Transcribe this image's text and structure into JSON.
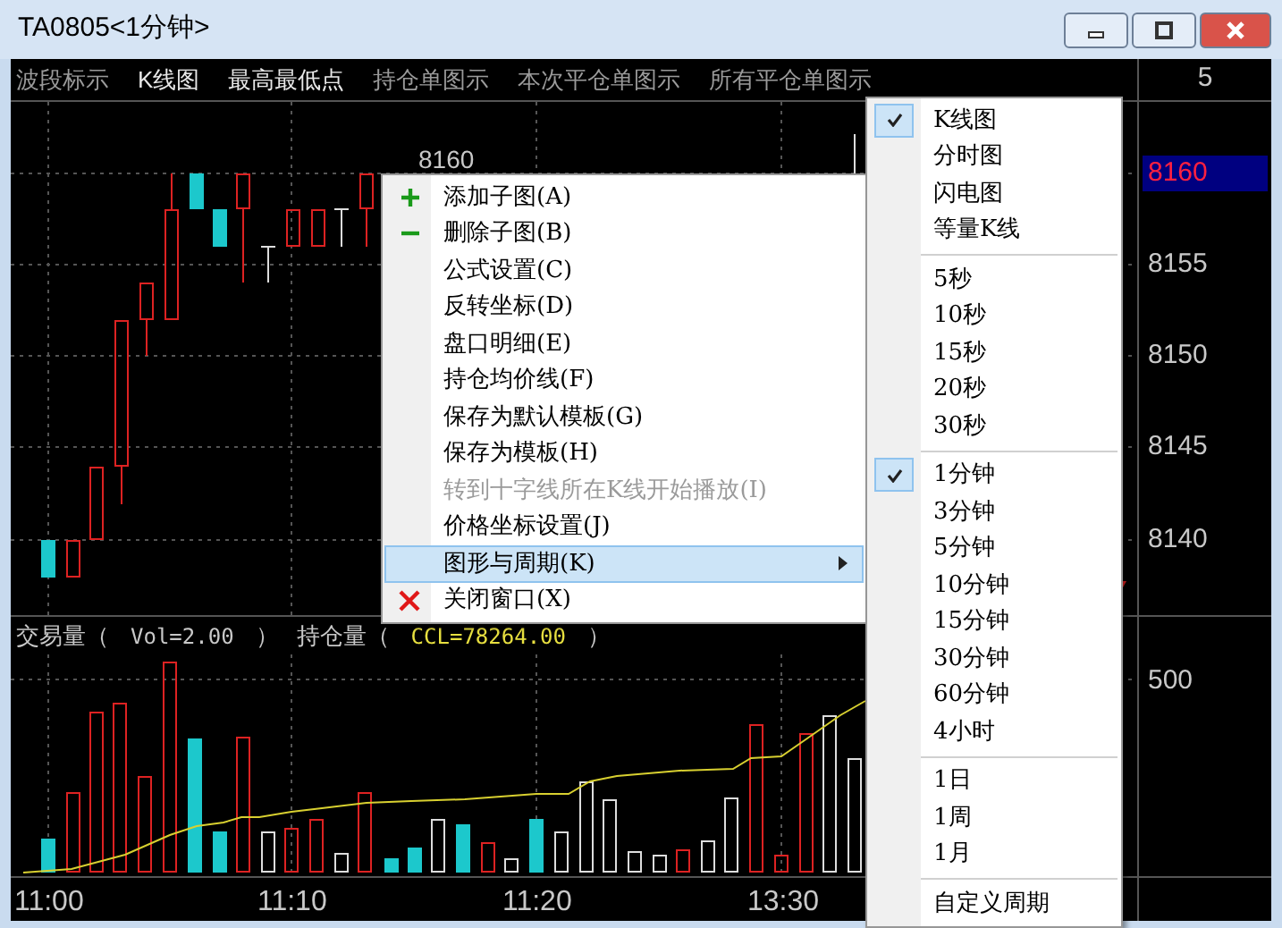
{
  "window": {
    "title": "TA0805<1分钟>"
  },
  "toolbar": [
    {
      "label": "波段标示",
      "on": false
    },
    {
      "label": "K线图",
      "on": true
    },
    {
      "label": "最高最低点",
      "on": true
    },
    {
      "label": "持仓单图示",
      "on": false
    },
    {
      "label": "本次平仓单图示",
      "on": false
    },
    {
      "label": "所有平仓单图示",
      "on": false
    }
  ],
  "toolbar_value": "5",
  "price_chart": {
    "high_label": "8160",
    "axis": [
      {
        "label": "8160",
        "selected": true
      },
      {
        "label": "8155",
        "selected": false
      },
      {
        "label": "8150",
        "selected": false
      },
      {
        "label": "8145",
        "selected": false
      },
      {
        "label": "8140",
        "selected": false
      }
    ]
  },
  "volume_header": [
    {
      "text": "交易量（",
      "kind": "label"
    },
    {
      "text": "Vol=2.00",
      "kind": "value"
    },
    {
      "text": "）",
      "kind": "label"
    },
    {
      "text": "持仓量（",
      "kind": "label"
    },
    {
      "text": "CCL=78264.00",
      "kind": "highlight"
    },
    {
      "text": "）",
      "kind": "label"
    }
  ],
  "volume_axis": "500",
  "time_axis": [
    "11:00",
    "11:10",
    "11:20",
    "13:30"
  ],
  "context_menu": [
    {
      "label": "添加子图(A)",
      "kind": "add",
      "disabled": false,
      "selected": false,
      "submenu": false
    },
    {
      "label": "删除子图(B)",
      "kind": "remove",
      "disabled": false,
      "selected": false,
      "submenu": false
    },
    {
      "label": "公式设置(C)",
      "disabled": false,
      "selected": false,
      "submenu": false
    },
    {
      "label": "反转坐标(D)",
      "disabled": false,
      "selected": false,
      "submenu": false
    },
    {
      "label": "盘口明细(E)",
      "disabled": false,
      "selected": false,
      "submenu": false
    },
    {
      "label": "持仓均价线(F)",
      "disabled": false,
      "selected": false,
      "submenu": false
    },
    {
      "label": "保存为默认模板(G)",
      "disabled": false,
      "selected": false,
      "submenu": false
    },
    {
      "label": "保存为模板(H)",
      "disabled": false,
      "selected": false,
      "submenu": false
    },
    {
      "label": "转到十字线所在K线开始播放(I)",
      "disabled": true,
      "selected": false,
      "submenu": false
    },
    {
      "label": "价格坐标设置(J)",
      "disabled": false,
      "selected": false,
      "submenu": false
    },
    {
      "label": "图形与周期(K)",
      "disabled": false,
      "selected": true,
      "submenu": true
    },
    {
      "label": "关闭窗口(X)",
      "kind": "close",
      "disabled": false,
      "selected": false,
      "submenu": false
    }
  ],
  "submenu": [
    [
      {
        "label": "K线图",
        "checked": true
      },
      {
        "label": "分时图",
        "checked": false
      },
      {
        "label": "闪电图",
        "checked": false
      },
      {
        "label": "等量K线",
        "checked": false
      }
    ],
    [
      {
        "label": "5秒",
        "checked": false
      },
      {
        "label": "10秒",
        "checked": false
      },
      {
        "label": "15秒",
        "checked": false
      },
      {
        "label": "20秒",
        "checked": false
      },
      {
        "label": "30秒",
        "checked": false
      }
    ],
    [
      {
        "label": "1分钟",
        "checked": true
      },
      {
        "label": "3分钟",
        "checked": false
      },
      {
        "label": "5分钟",
        "checked": false
      },
      {
        "label": "10分钟",
        "checked": false
      },
      {
        "label": "15分钟",
        "checked": false
      },
      {
        "label": "30分钟",
        "checked": false
      },
      {
        "label": "60分钟",
        "checked": false
      },
      {
        "label": "4小时",
        "checked": false
      }
    ],
    [
      {
        "label": "1日",
        "checked": false
      },
      {
        "label": "1周",
        "checked": false
      },
      {
        "label": "1月",
        "checked": false
      }
    ],
    [
      {
        "label": "自定义周期",
        "checked": false
      }
    ]
  ]
}
